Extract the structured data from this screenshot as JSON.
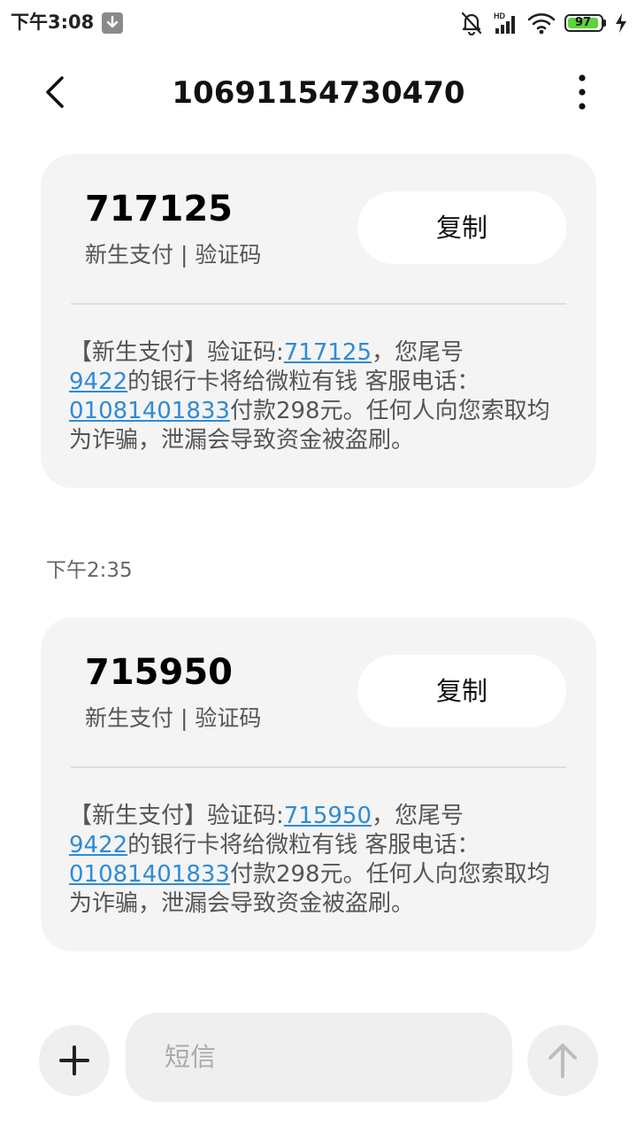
{
  "status_bar": {
    "time": "下午3:08",
    "battery_level": "97",
    "network_label": "HD",
    "icons": [
      "download-icon",
      "mute-bell-icon",
      "signal-icon",
      "wifi-icon",
      "battery-icon",
      "charging-icon"
    ]
  },
  "header": {
    "title": "10691154730470",
    "back_icon": "back-chevron-icon",
    "more_icon": "more-vertical-icon"
  },
  "messages": [
    {
      "code": "717125",
      "subtitle": "新生支付 | 验证码",
      "copy_label": "复制",
      "body": {
        "l1_prefix": "【新生支付】验证码:",
        "l1_code": "717125",
        "l1_suffix": "，您尾号",
        "l2_card": "9422",
        "l2_text": "的银行卡将给微粒有钱 客服电话：",
        "l3_phone": "01081401833",
        "l3_text": "付款298元。任何人向您索取均",
        "l4_text": "为诈骗，泄漏会导致资金被盗刷。"
      }
    },
    {
      "timestamp": "下午2:35",
      "code": "715950",
      "subtitle": "新生支付 | 验证码",
      "copy_label": "复制",
      "body": {
        "l1_prefix": "【新生支付】验证码:",
        "l1_code": "715950",
        "l1_suffix": "，您尾号",
        "l2_card": "9422",
        "l2_text": "的银行卡将给微粒有钱 客服电话：",
        "l3_phone": "01081401833",
        "l3_text": "付款298元。任何人向您索取均",
        "l4_text": "为诈骗，泄漏会导致资金被盗刷。"
      }
    }
  ],
  "compose": {
    "placeholder": "短信",
    "add_icon": "plus-icon",
    "send_icon": "send-arrow-icon"
  },
  "colors": {
    "link": "#2f8bd6",
    "card_bg": "#f4f4f4",
    "battery_fill": "#5bd33b"
  }
}
